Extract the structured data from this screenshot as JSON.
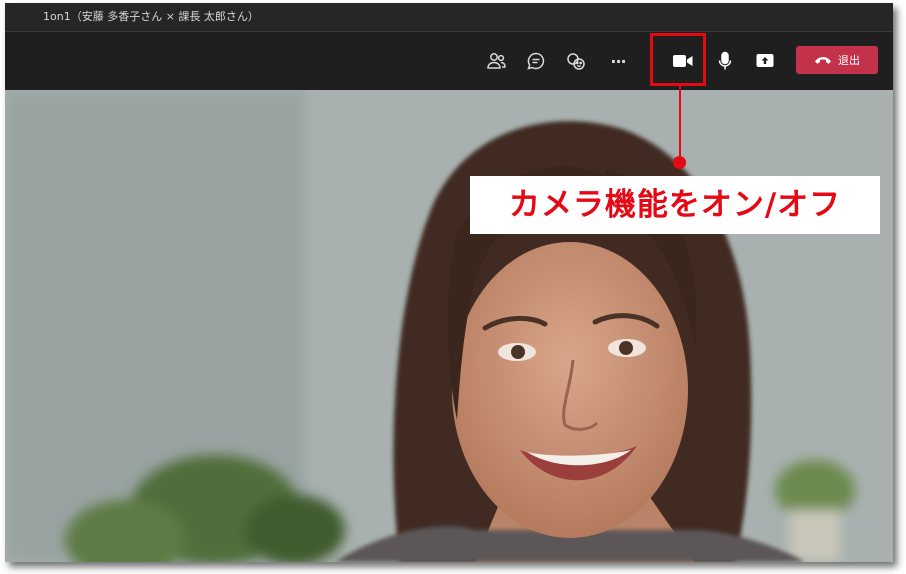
{
  "window": {
    "title": "1on1（安藤 多香子さん × 課長 太郎さん）"
  },
  "toolbar": {
    "icons": [
      "people-icon",
      "chat-icon",
      "reactions-icon",
      "more-icon",
      "camera-icon",
      "microphone-icon",
      "share-icon",
      "phone-hangup-icon"
    ],
    "more_label": "···",
    "leave_label": "退出",
    "leave_color": "#c4314b"
  },
  "annotation": {
    "label": "カメラ機能をオン/オフ",
    "color": "#e50914"
  }
}
